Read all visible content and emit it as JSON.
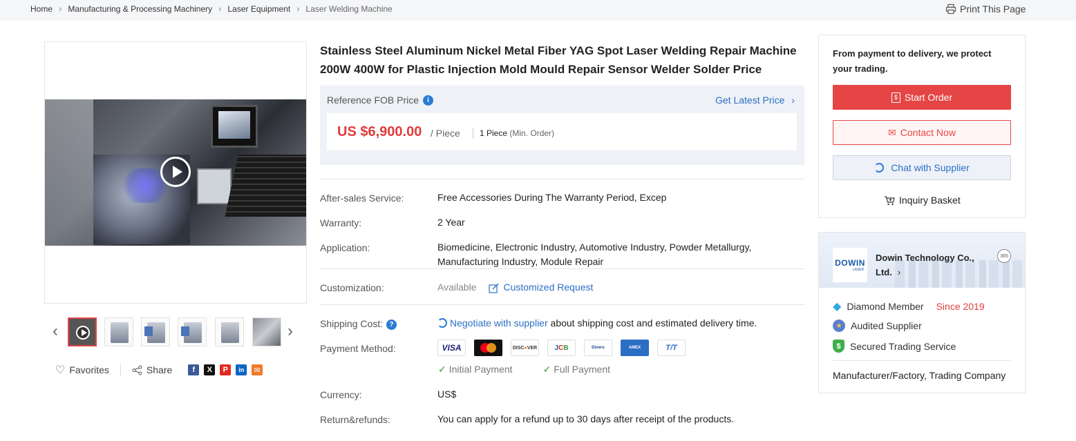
{
  "breadcrumb": {
    "items": [
      "Home",
      "Manufacturing & Processing Machinery",
      "Laser Equipment",
      "Laser Welding Machine"
    ],
    "print_label": "Print This Page"
  },
  "product": {
    "title_line1": "Stainless Steel Aluminum Nickel Metal Fiber YAG Spot Laser Welding Repair Machine",
    "title_line2": "200W 400W for Plastic Injection Mold Mould Repair Sensor Welder Solder Price",
    "price_label": "Reference FOB Price",
    "latest_price_link": "Get Latest Price",
    "price": "US $6,900.00",
    "unit": "/ Piece",
    "moq_value": "1 Piece",
    "moq_label": "(Min. Order)"
  },
  "gallery": {
    "thumb_count": 6,
    "actions": {
      "favorites": "Favorites",
      "share": "Share"
    },
    "social_icons": [
      {
        "name": "facebook-icon",
        "glyph": "f",
        "color": "#3b5998"
      },
      {
        "name": "x-icon",
        "glyph": "X",
        "color": "#111111"
      },
      {
        "name": "pinterest-icon",
        "glyph": "P",
        "color": "#e02a20"
      },
      {
        "name": "linkedin-icon",
        "glyph": "in",
        "color": "#0a66c2"
      },
      {
        "name": "email-icon",
        "glyph": "✉",
        "color": "#f07a2b"
      }
    ]
  },
  "specs": {
    "after_sales_label": "After-sales Service:",
    "after_sales_value": "Free Accessories During The Warranty Period, Excep",
    "warranty_label": "Warranty:",
    "warranty_value": "2 Year",
    "application_label": "Application:",
    "application_line1": "Biomedicine, Electronic Industry, Automotive Industry, Powder Metallurgy,",
    "application_line2": "Manufacturing Industry, Module Repair",
    "customization_label": "Customization:",
    "customization_value": "Available",
    "customization_link": "Customized Request",
    "shipping_label": "Shipping Cost:",
    "shipping_link": "Negotiate with supplier",
    "shipping_text": " about shipping cost and estimated delivery time.",
    "payment_label": "Payment Method:",
    "payment_cards": [
      {
        "name": "visa-card-icon",
        "text": "VISA",
        "color": "#1a1f71"
      },
      {
        "name": "mastercard-icon",
        "text": "●●",
        "color": "#eb001b"
      },
      {
        "name": "discover-card-icon",
        "text": "DISCOVER",
        "color": "#333333"
      },
      {
        "name": "jcb-card-icon",
        "text": "JCB",
        "color": "#0b5aa8"
      },
      {
        "name": "diners-club-icon",
        "text": "Diners",
        "color": "#1a4c8b"
      },
      {
        "name": "amex-card-icon",
        "text": "AMEX",
        "color": "#ffffff"
      },
      {
        "name": "tt-transfer-icon",
        "text": "T/T",
        "color": "#2b6fc4"
      }
    ],
    "initial_payment": "Initial Payment",
    "full_payment": "Full Payment",
    "currency_label": "Currency:",
    "currency_value": "US$",
    "refund_label": "Return&refunds:",
    "refund_value": "You can apply for a refund up to 30 days after receipt of the products."
  },
  "protection": {
    "text_line1": "From payment to delivery, we protect",
    "text_line2": "your trading.",
    "start_order": "Start Order",
    "contact_now": "Contact Now",
    "chat": "Chat with Supplier",
    "basket": "Inquiry Basket"
  },
  "supplier": {
    "logo_text": "DOWIN",
    "logo_sub": "LASER",
    "name_line1": "Dowin Technology Co.,",
    "name_line2": "Ltd.",
    "badge": "365",
    "member": "Diamond Member",
    "since": "Since 2019",
    "audited": "Audited Supplier",
    "secured": "Secured Trading Service",
    "type": "Manufacturer/Factory, Trading Company"
  },
  "colors": {
    "accent_red": "#e64545",
    "link_blue": "#2b6fc4"
  }
}
